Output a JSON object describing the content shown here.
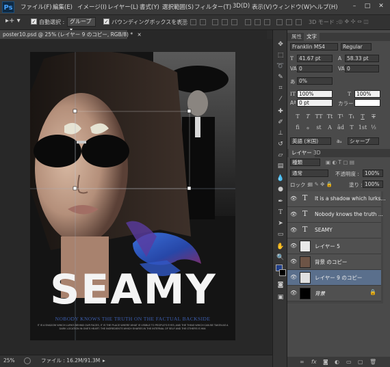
{
  "app": {
    "logo": "Ps"
  },
  "menu": [
    "ファイル(F)",
    "編集(E)",
    "イメージ(I)",
    "レイヤー(L)",
    "書式(Y)",
    "選択範囲(S)",
    "フィルター(T)",
    "3D(D)",
    "表示(V)",
    "ウィンドウ(W)",
    "ヘルプ(H)"
  ],
  "window_controls": {
    "minimize": "–",
    "maximize": "□",
    "close": "✕"
  },
  "options": {
    "auto_select_label": "自動選択 :",
    "auto_select_value": "グループ",
    "bounding_box_label": "バウンディングボックスを表示",
    "mode_3d": "3D モード :"
  },
  "document": {
    "tab_title": "poster10.psd @ 25% (レイヤー 9 のコピー, RGB/8) *",
    "close": "×"
  },
  "poster": {
    "headline": "SEAMY",
    "tagline": "NOBODY KNOWS THE TRUTH ON THE FACTUAL BACKSIDE",
    "body": "IT IS A SHADOW WHICH LURKS BEHIND OUR FACES, IT IS THE PLACE WHERE WHAT IS VISIBLE TO PEOPLE'S EYES, AND THE THING WHICH CAN BE TAKEN AS A DARK LOCATION IN ONE'S HEART. THE INGREDIENTS WHICH SHARES IN THE INTERNAL OF SELF AND THE OTHERS IS HIM."
  },
  "status": {
    "zoom": "25%",
    "file_info": "ファイル : 16.2M/91.3M"
  },
  "character_panel": {
    "tabs": [
      "属性",
      "文字"
    ],
    "font_family": "Franklin MS4",
    "font_style": "Regular",
    "font_size": "41.67 pt",
    "leading": "58.33 pt",
    "kerning": "0",
    "tracking": "0",
    "vert_scale_pct": "0%",
    "vscale": "100%",
    "hscale": "100%",
    "baseline": "0 pt",
    "color_label": "カラー :",
    "color_value": "#ffffff",
    "style_buttons": [
      "T",
      "T",
      "TT",
      "Tt",
      "T¹",
      "T₁",
      "T",
      "T"
    ],
    "extra_buttons": [
      "fi",
      "ℴ",
      "st",
      "A",
      "ād",
      "T",
      "1st",
      "½"
    ],
    "language": "英語 (米国)",
    "antialias": "シャープ",
    "aa_prefix": "aₐ"
  },
  "layers_panel": {
    "tabs": [
      "レイヤー",
      "3D"
    ],
    "filter_kind": "種類",
    "blend_mode": "通常",
    "opacity_label": "不透明度 :",
    "opacity_value": "100%",
    "lock_label": "ロック :",
    "fill_label": "塗り :",
    "fill_value": "100%",
    "layers": [
      {
        "name": "It is a shadow which lurks...",
        "kind": "text",
        "selected": false
      },
      {
        "name": "Nobody knows the truth ...",
        "kind": "text",
        "selected": false
      },
      {
        "name": "SEAMY",
        "kind": "text",
        "selected": false
      },
      {
        "name": "レイヤー 5",
        "kind": "image",
        "selected": false
      },
      {
        "name": "背景 のコピー",
        "kind": "image",
        "selected": false
      },
      {
        "name": "レイヤー 9 のコピー",
        "kind": "image",
        "selected": true
      },
      {
        "name": "背景",
        "kind": "background",
        "selected": false
      }
    ],
    "footer_icons": [
      "link-icon",
      "fx-icon",
      "mask-icon",
      "adjustment-icon",
      "group-icon",
      "new-layer-icon",
      "trash-icon"
    ]
  }
}
